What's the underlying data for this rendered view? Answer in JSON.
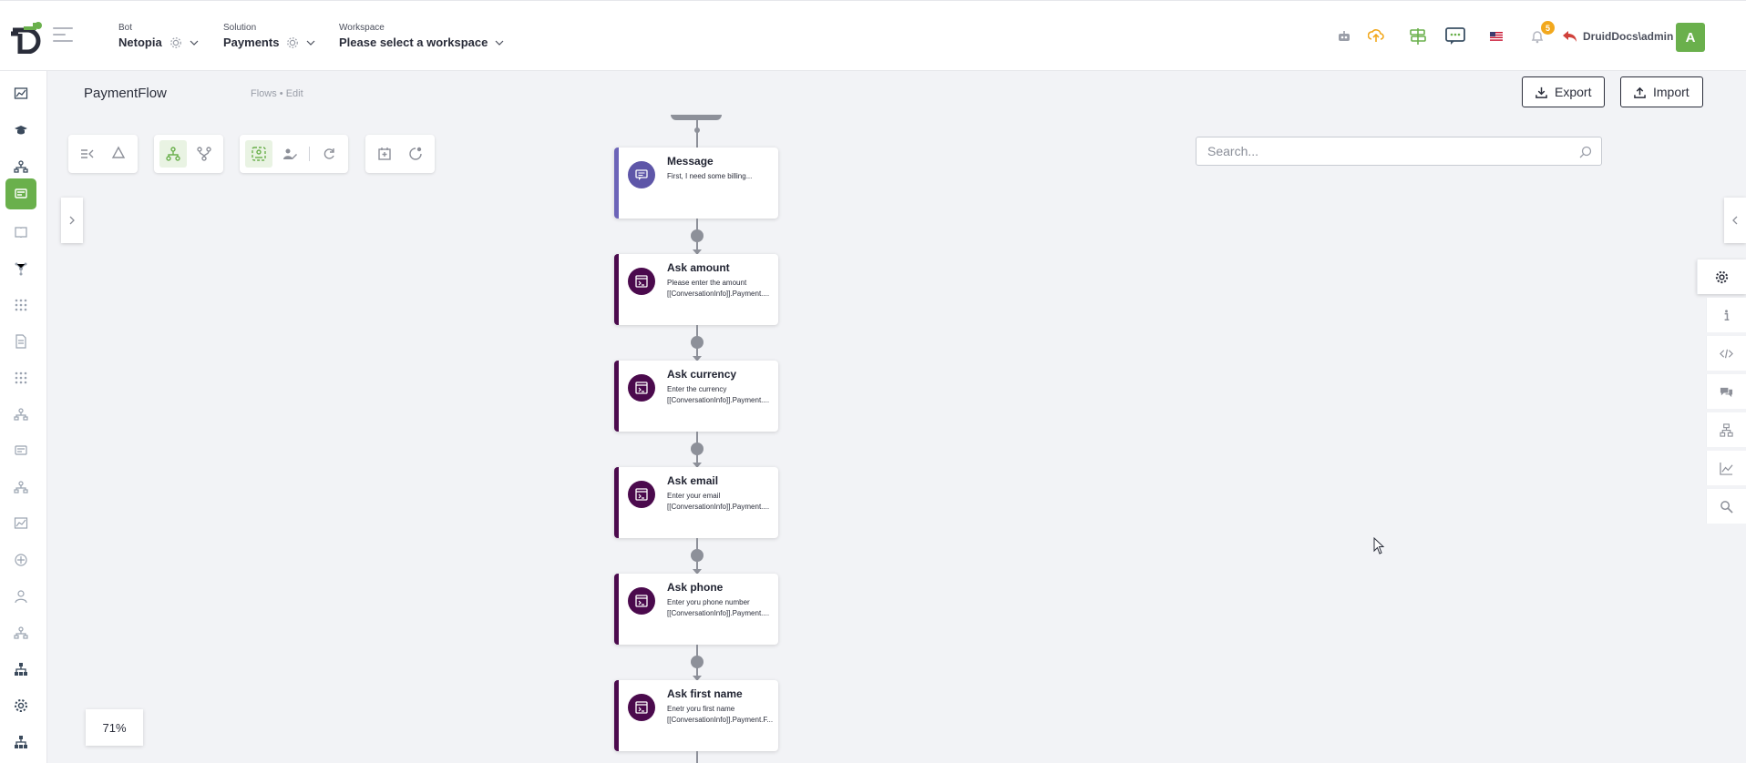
{
  "header": {
    "bot": {
      "label": "Bot",
      "value": "Netopia"
    },
    "solution": {
      "label": "Solution",
      "value": "Payments"
    },
    "workspace": {
      "label": "Workspace",
      "value": "Please select a workspace"
    },
    "notifications_count": "5",
    "user_name": "DruidDocs\\admin",
    "avatar_initial": "A"
  },
  "titlebar": {
    "title": "PaymentFlow",
    "breadcrumb": "Flows  •  Edit",
    "export_label": "Export",
    "import_label": "Import"
  },
  "search": {
    "placeholder": "Search..."
  },
  "zoom": "71%",
  "nodes": [
    {
      "title": "Message",
      "line1": "First, I need some billing...",
      "line2": ""
    },
    {
      "title": "Ask amount",
      "line1": "Please enter the amount",
      "line2": "[[ConversationInfo]].Payment...."
    },
    {
      "title": "Ask currency",
      "line1": "Enter the currency",
      "line2": "[[ConversationInfo]].Payment...."
    },
    {
      "title": "Ask email",
      "line1": "Enter your email",
      "line2": "[[ConversationInfo]].Payment...."
    },
    {
      "title": "Ask phone",
      "line1": "Enter yoru phone number",
      "line2": "[[ConversationInfo]].Payment...."
    },
    {
      "title": "Ask first name",
      "line1": "Enetr yoru first name",
      "line2": "[[ConversationInfo]].Payment.F..."
    }
  ],
  "colors": {
    "accent": "#6ab04c",
    "node_border": "#4b0a4d",
    "message_border": "#6c64b8",
    "badge": "#f2a81d"
  }
}
